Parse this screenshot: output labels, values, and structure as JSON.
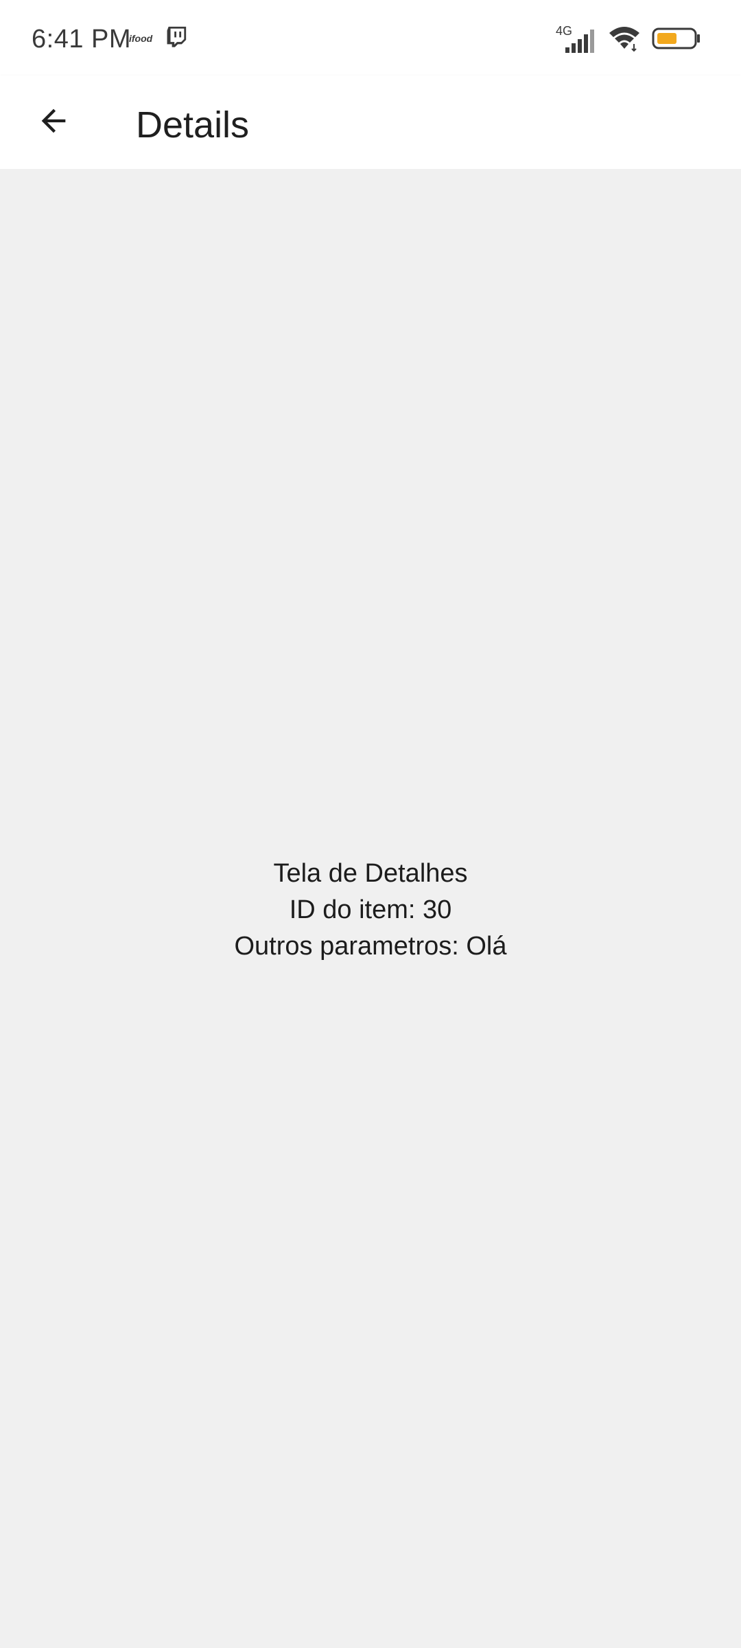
{
  "status_bar": {
    "time": "6:41 PM",
    "ifood_label": "ifood",
    "network_label": "4G",
    "battery_color": "#f2a81d"
  },
  "app_bar": {
    "title": "Details",
    "back_icon": "arrow-left-icon"
  },
  "content": {
    "line1": "Tela de Detalhes",
    "line2": "ID do item: 30",
    "line3": "Outros parametros: Olá"
  }
}
